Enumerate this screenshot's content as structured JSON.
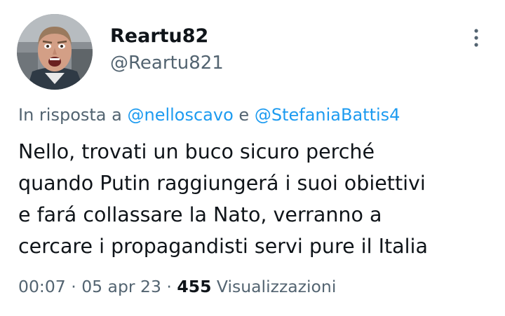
{
  "author": {
    "display_name": "Reartu82",
    "handle": "@Reartu821",
    "avatar": "avatar-photo"
  },
  "more_icon": "more-vertical-icon",
  "reply_context": {
    "prefix": "In risposta a",
    "mention_1": "@nelloscavo",
    "conjunction": "e",
    "mention_2": "@StefaniaBattis4"
  },
  "tweet": {
    "lines": [
      "Nello,  trovati un buco sicuro perché",
      "quando Putin raggiungerá i suoi obiettivi",
      "e fará collassare la Nato, verranno a",
      "cercare i propagandisti servi pure il Italia"
    ]
  },
  "meta": {
    "time": "00:07",
    "separator": "·",
    "date": "05 apr 23",
    "views_count": "455",
    "views_label": "Visualizzazioni"
  },
  "colors": {
    "text_primary": "#0f1419",
    "text_secondary": "#536471",
    "link": "#1d9bf0"
  }
}
